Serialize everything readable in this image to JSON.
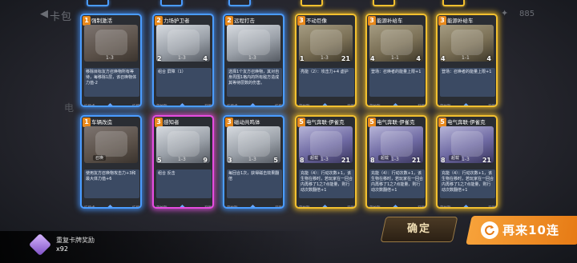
{
  "background": {
    "title": "卡包",
    "subtitle": "电",
    "count": "885"
  },
  "cards": [
    {
      "id": 1,
      "cost": "1",
      "name": "强制激活",
      "frame": "blue",
      "art": "red",
      "atk": "",
      "hp": "",
      "cost_text": "1-3",
      "text": "移除目标友方召唤物所有等待，每移除1层，该召唤物体力值-2",
      "footer_left": "技能卡",
      "footer_right": "技能"
    },
    {
      "id": 2,
      "cost": "2",
      "name": "力场护卫者",
      "frame": "blue",
      "art": "grey",
      "atk": "2",
      "hp": "4",
      "cost_text": "1-3",
      "mid": "",
      "text": "组合 屏障（1）",
      "footer_left": "贺帕斯",
      "footer_right": "召唤"
    },
    {
      "id": 3,
      "cost": "2",
      "name": "远程打击",
      "frame": "blue",
      "art": "grey",
      "atk": "",
      "hp": "",
      "cost_text": "1-3",
      "text": "选择1个友方召唤物，其对自身周围1格内的所有敌方造成其等待层数的伤害。",
      "footer_left": "技能卡",
      "footer_right": "技能"
    },
    {
      "id": 4,
      "cost": "3",
      "name": "不动巨像",
      "frame": "gold",
      "art": "tank",
      "atk": "1",
      "hp": "21",
      "cost_text": "1-3",
      "text": "亮能（2）：攻击力+4 虚护",
      "footer_left": "贺帕斯",
      "footer_right": "召唤"
    },
    {
      "id": 5,
      "cost": "3",
      "name": "能源补给车",
      "frame": "gold",
      "art": "tank",
      "atk": "4",
      "hp": "4",
      "cost_text": "1-1",
      "text": "登场：召唤者的能量上限+1",
      "footer_left": "贺帕斯",
      "footer_right": "召唤"
    },
    {
      "id": 6,
      "cost": "3",
      "name": "能源补给车",
      "frame": "gold",
      "art": "tank",
      "atk": "4",
      "hp": "4",
      "cost_text": "1-1",
      "text": "登场：召唤者的能量上限+1",
      "footer_left": "贺帕斯",
      "footer_right": "召唤"
    },
    {
      "id": 7,
      "cost": "1",
      "name": "车辆改造",
      "frame": "blue",
      "art": "red",
      "atk": "",
      "hp": "",
      "cost_text": "",
      "mid": "召唤",
      "text": "使用友方召唤物攻击力+3和最大体力值+6",
      "footer_left": "技能卡",
      "footer_right": "技能"
    },
    {
      "id": 8,
      "cost": "3",
      "name": "感知者",
      "frame": "pink",
      "art": "grey",
      "atk": "5",
      "hp": "9",
      "cost_text": "1-3",
      "text": "组合 反击",
      "footer_left": "贺帕斯",
      "footer_right": "召唤"
    },
    {
      "id": 9,
      "cost": "3",
      "name": "磁动共鸣体",
      "frame": "blue",
      "art": "grey",
      "atk": "3",
      "hp": "5",
      "cost_text": "1-3",
      "text": "每回合1次，获得磁击效果翻倍",
      "footer_left": "贺帕斯",
      "footer_right": "召唤"
    },
    {
      "id": 10,
      "cost": "5",
      "name": "电气奔联·伊雀克",
      "frame": "gold",
      "art": "purple",
      "atk": "8",
      "hp": "21",
      "cost_text": "1-3",
      "mid": "超载",
      "text": "充能（4）：行动次数+1，该生物在移时，若玩家在一回合内再移了1之7点能量，则行动次数翻倍+1",
      "footer_left": "贺帕斯",
      "footer_right": "召唤"
    },
    {
      "id": 11,
      "cost": "5",
      "name": "电气奔联·伊雀克",
      "frame": "gold",
      "art": "purple",
      "atk": "8",
      "hp": "21",
      "cost_text": "1-3",
      "mid": "超载",
      "text": "充能（4）：行动次数+1，该生物在移时，若玩家在一回合内再移了1之7点能量，则行动次数翻倍+1",
      "footer_left": "贺帕斯",
      "footer_right": "召唤"
    },
    {
      "id": 12,
      "cost": "5",
      "name": "电气奔联·伊雀克",
      "frame": "gold",
      "art": "purple",
      "atk": "8",
      "hp": "21",
      "cost_text": "1-3",
      "mid": "超载",
      "text": "充能（4）：行动次数+1，该生物在移时，若玩家在一回合内再移了1之7点能量，则行动次数翻倍+1",
      "footer_left": "贺帕斯",
      "footer_right": "召唤"
    }
  ],
  "buttons": {
    "confirm": "确定",
    "again": "再来10连"
  },
  "reward": {
    "title": "重复卡牌奖励",
    "count": "x92"
  },
  "colors": {
    "blue_frame": "#4a9cff",
    "gold_frame": "#f2c030",
    "pink_frame": "#e64ce0",
    "again_button": "#f2922a"
  }
}
